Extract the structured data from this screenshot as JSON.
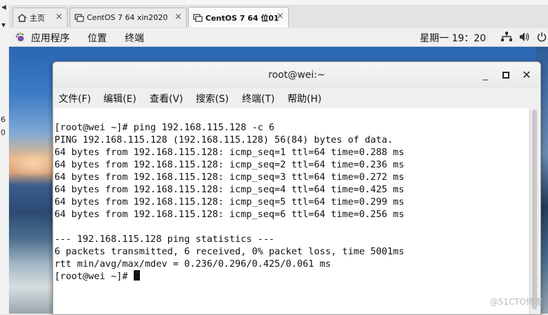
{
  "left_edge": {
    "nums": [
      "6",
      "0"
    ]
  },
  "tabs": [
    {
      "label": "主页",
      "icon": "home-icon"
    },
    {
      "label": "CentOS 7 64 xin2020",
      "icon": "vm-icon"
    },
    {
      "label": "CentOS 7 64 位01",
      "icon": "vm-icon",
      "active": true
    }
  ],
  "panel": {
    "applications": "应用程序",
    "places": "位置",
    "terminal": "终端",
    "clock": "星期一 19：20"
  },
  "terminal": {
    "title": "root@wei:~",
    "menu": [
      "文件(F)",
      "编辑(E)",
      "查看(V)",
      "搜索(S)",
      "终端(T)",
      "帮助(H)"
    ],
    "lines": [
      "[root@wei ~]# ping 192.168.115.128 -c 6",
      "PING 192.168.115.128 (192.168.115.128) 56(84) bytes of data.",
      "64 bytes from 192.168.115.128: icmp_seq=1 ttl=64 time=0.288 ms",
      "64 bytes from 192.168.115.128: icmp_seq=2 ttl=64 time=0.236 ms",
      "64 bytes from 192.168.115.128: icmp_seq=3 ttl=64 time=0.272 ms",
      "64 bytes from 192.168.115.128: icmp_seq=4 ttl=64 time=0.425 ms",
      "64 bytes from 192.168.115.128: icmp_seq=5 ttl=64 time=0.299 ms",
      "64 bytes from 192.168.115.128: icmp_seq=6 ttl=64 time=0.256 ms",
      "",
      "--- 192.168.115.128 ping statistics ---",
      "6 packets transmitted, 6 received, 0% packet loss, time 5001ms",
      "rtt min/avg/max/mdev = 0.236/0.296/0.425/0.061 ms"
    ],
    "prompt": "[root@wei ~]# "
  },
  "watermark": "@51CTO博客"
}
